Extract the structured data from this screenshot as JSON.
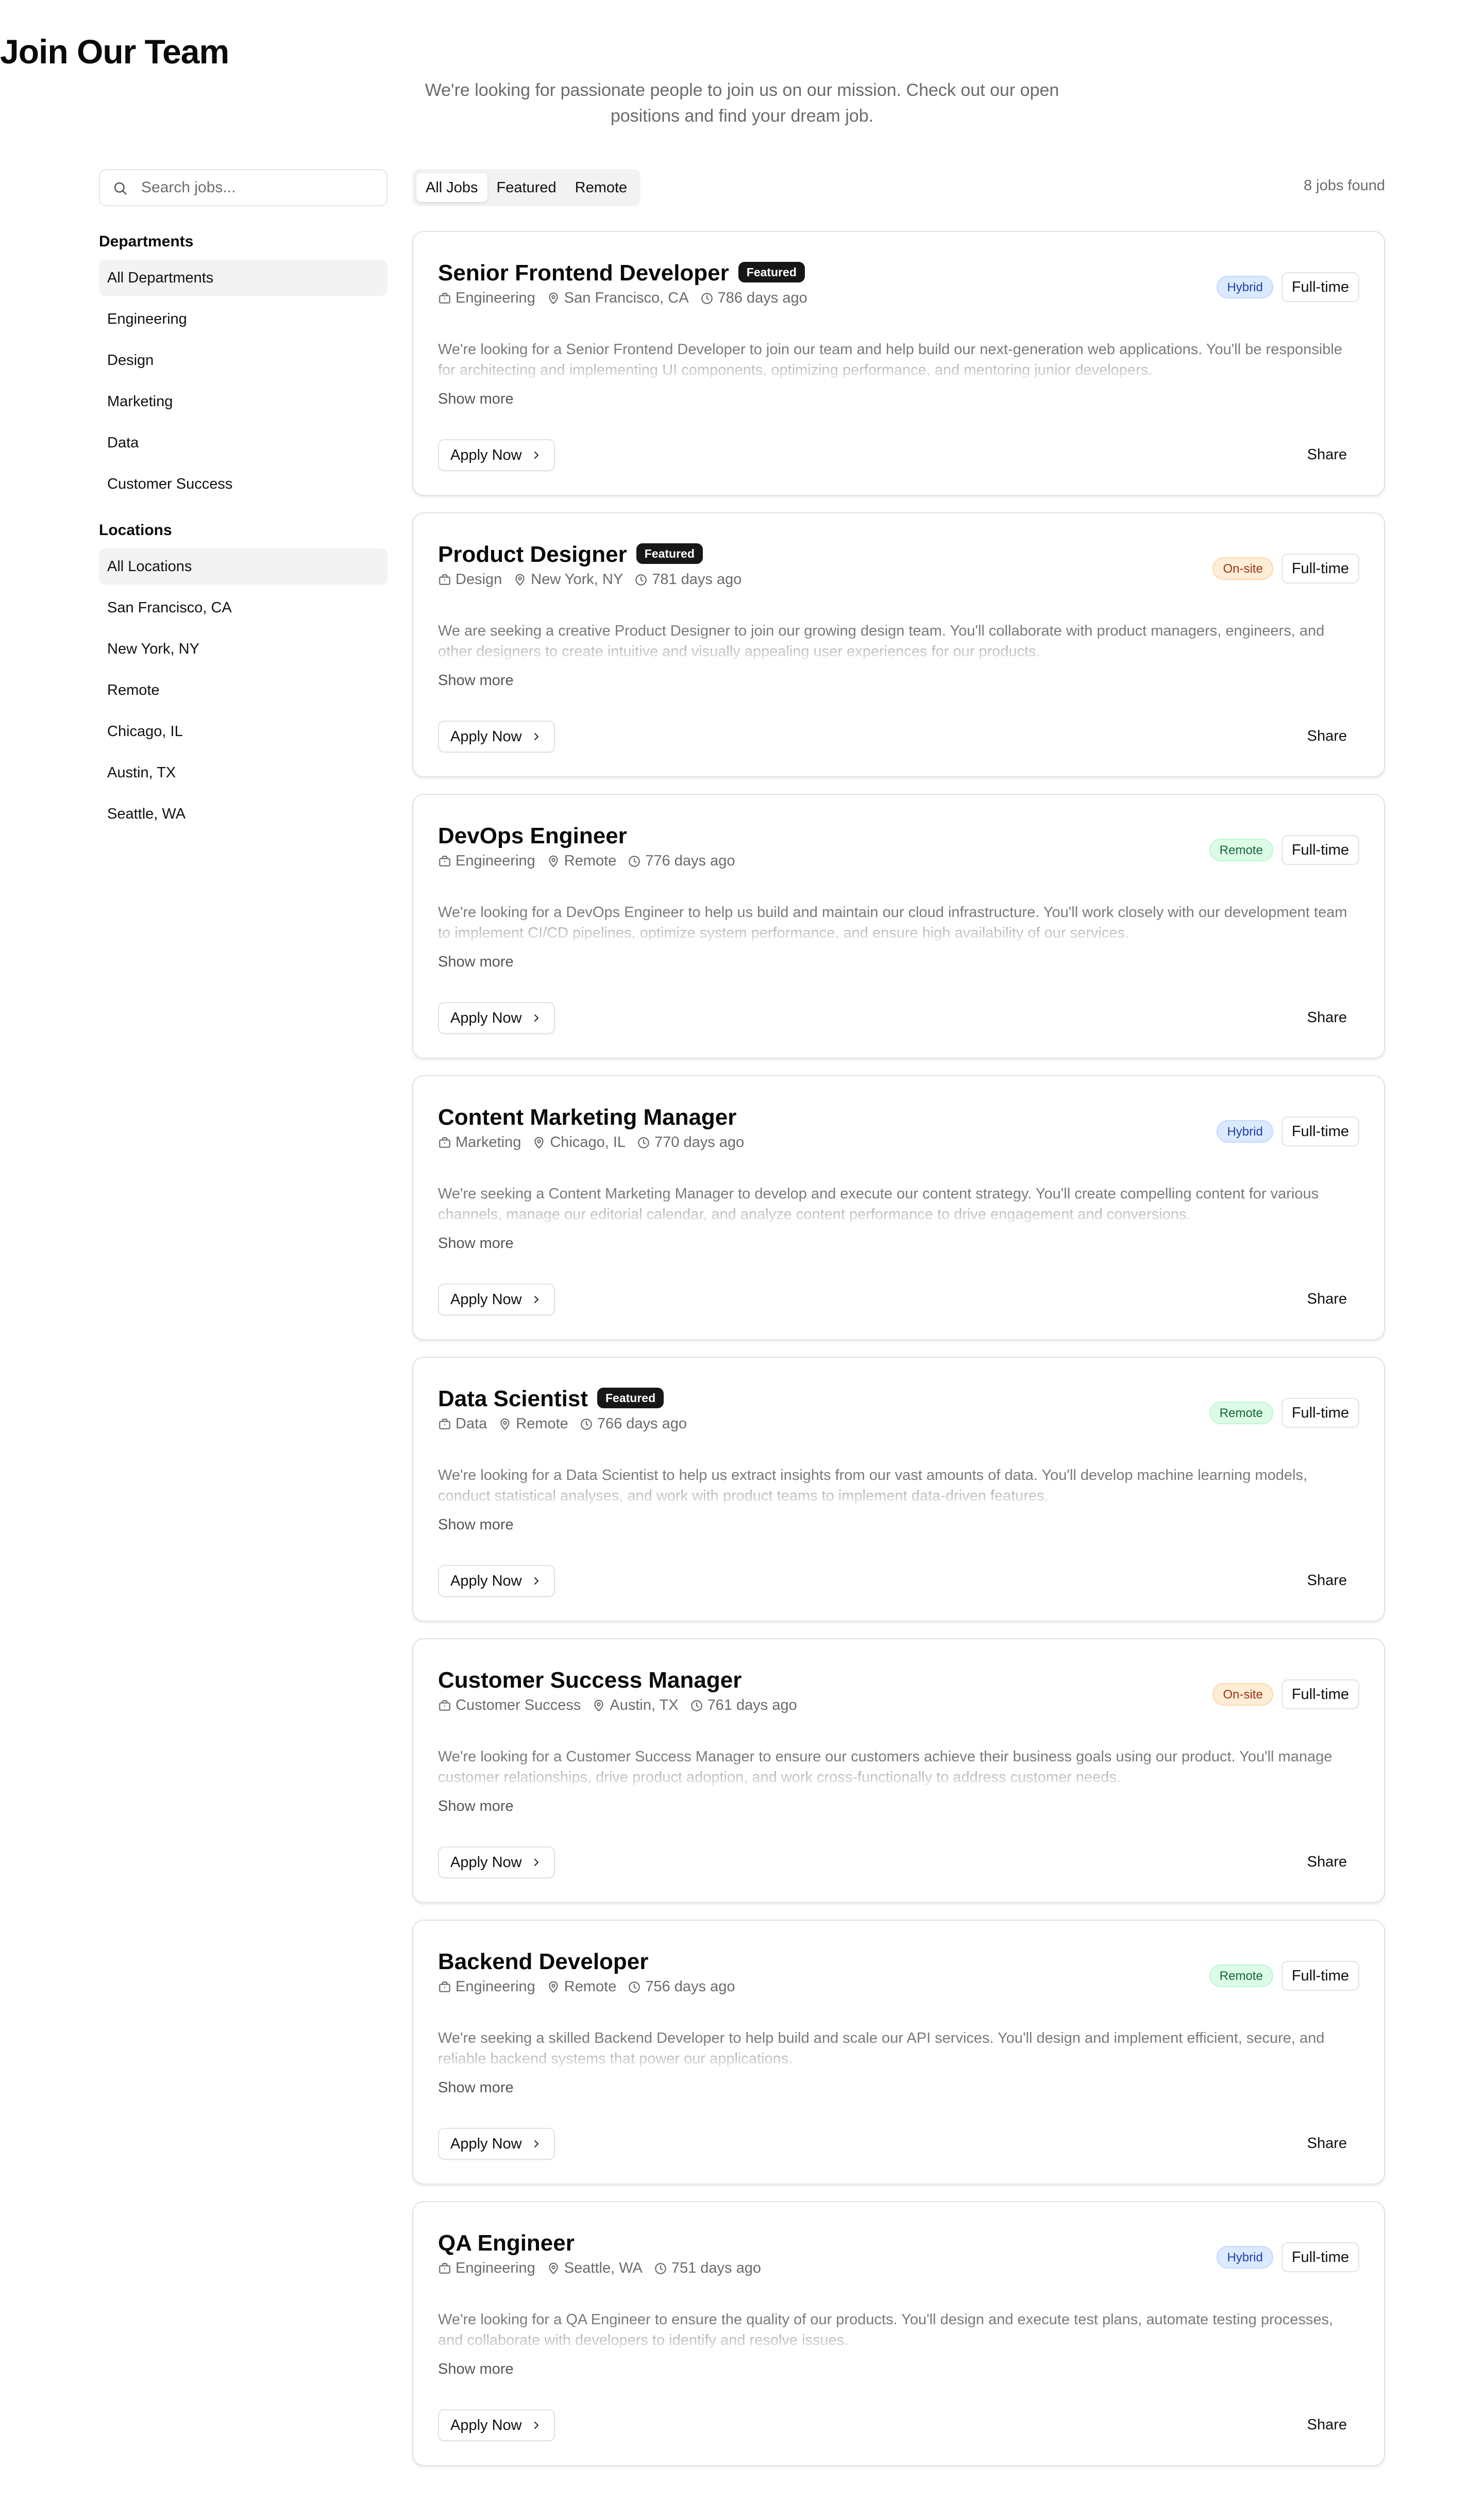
{
  "page": {
    "title": "Join Our Team",
    "subtitle": "We're looking for passionate people to join us on our mission. Check out our open positions and find your dream job."
  },
  "search": {
    "placeholder": "Search jobs..."
  },
  "departments": {
    "heading": "Departments",
    "items": [
      "All Departments",
      "Engineering",
      "Design",
      "Marketing",
      "Data",
      "Customer Success"
    ],
    "selected": "All Departments"
  },
  "locations": {
    "heading": "Locations",
    "items": [
      "All Locations",
      "San Francisco, CA",
      "New York, NY",
      "Remote",
      "Chicago, IL",
      "Austin, TX",
      "Seattle, WA"
    ],
    "selected": "All Locations"
  },
  "tabs": {
    "items": [
      "All Jobs",
      "Featured",
      "Remote"
    ],
    "active": "All Jobs"
  },
  "results": {
    "count_text": "8 jobs found"
  },
  "card_labels": {
    "featured": "Featured",
    "show_more": "Show more",
    "apply": "Apply Now",
    "share": "Share"
  },
  "colors": {
    "hybrid": "#1e40af",
    "onsite": "#9a3412",
    "remote": "#166534",
    "featured_bg": "#171717"
  },
  "jobs": [
    {
      "title": "Senior Frontend Developer",
      "featured": true,
      "department": "Engineering",
      "location": "San Francisco, CA",
      "posted": "786 days ago",
      "work_type": "Hybrid",
      "employment": "Full-time",
      "description": "We're looking for a Senior Frontend Developer to join our team and help build our next-generation web applications. You'll be responsible for architecting and implementing UI components, optimizing performance, and mentoring junior developers."
    },
    {
      "title": "Product Designer",
      "featured": true,
      "department": "Design",
      "location": "New York, NY",
      "posted": "781 days ago",
      "work_type": "On-site",
      "employment": "Full-time",
      "description": "We are seeking a creative Product Designer to join our growing design team. You'll collaborate with product managers, engineers, and other designers to create intuitive and visually appealing user experiences for our products."
    },
    {
      "title": "DevOps Engineer",
      "featured": false,
      "department": "Engineering",
      "location": "Remote",
      "posted": "776 days ago",
      "work_type": "Remote",
      "employment": "Full-time",
      "description": "We're looking for a DevOps Engineer to help us build and maintain our cloud infrastructure. You'll work closely with our development team to implement CI/CD pipelines, optimize system performance, and ensure high availability of our services."
    },
    {
      "title": "Content Marketing Manager",
      "featured": false,
      "department": "Marketing",
      "location": "Chicago, IL",
      "posted": "770 days ago",
      "work_type": "Hybrid",
      "employment": "Full-time",
      "description": "We're seeking a Content Marketing Manager to develop and execute our content strategy. You'll create compelling content for various channels, manage our editorial calendar, and analyze content performance to drive engagement and conversions."
    },
    {
      "title": "Data Scientist",
      "featured": true,
      "department": "Data",
      "location": "Remote",
      "posted": "766 days ago",
      "work_type": "Remote",
      "employment": "Full-time",
      "description": "We're looking for a Data Scientist to help us extract insights from our vast amounts of data. You'll develop machine learning models, conduct statistical analyses, and work with product teams to implement data-driven features."
    },
    {
      "title": "Customer Success Manager",
      "featured": false,
      "department": "Customer Success",
      "location": "Austin, TX",
      "posted": "761 days ago",
      "work_type": "On-site",
      "employment": "Full-time",
      "description": "We're looking for a Customer Success Manager to ensure our customers achieve their business goals using our product. You'll manage customer relationships, drive product adoption, and work cross-functionally to address customer needs."
    },
    {
      "title": "Backend Developer",
      "featured": false,
      "department": "Engineering",
      "location": "Remote",
      "posted": "756 days ago",
      "work_type": "Remote",
      "employment": "Full-time",
      "description": "We're seeking a skilled Backend Developer to help build and scale our API services. You'll design and implement efficient, secure, and reliable backend systems that power our applications."
    },
    {
      "title": "QA Engineer",
      "featured": false,
      "department": "Engineering",
      "location": "Seattle, WA",
      "posted": "751 days ago",
      "work_type": "Hybrid",
      "employment": "Full-time",
      "description": "We're looking for a QA Engineer to ensure the quality of our products. You'll design and execute test plans, automate testing processes, and collaborate with developers to identify and resolve issues."
    }
  ]
}
